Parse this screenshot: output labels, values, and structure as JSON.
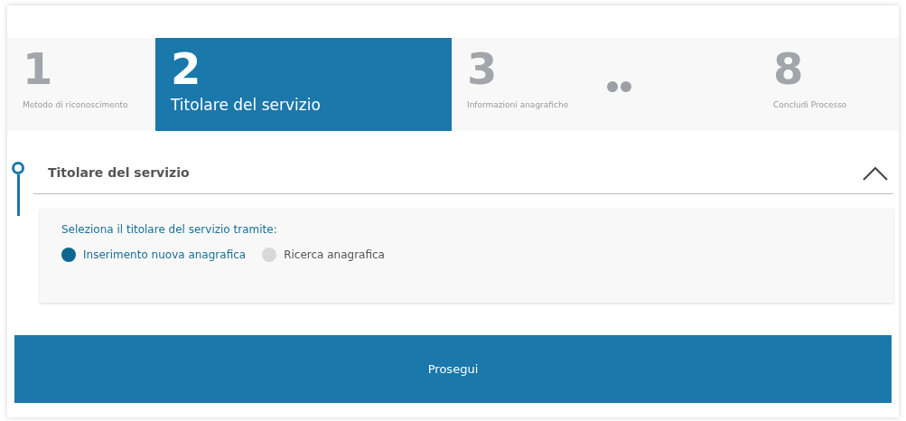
{
  "steps": [
    {
      "kind": "number",
      "number": "1",
      "label": "Metodo di riconoscimento",
      "selected": false
    },
    {
      "kind": "number",
      "number": "2",
      "label": "Titolare del servizio",
      "selected": true
    },
    {
      "kind": "number",
      "number": "3",
      "label": "Informazioni anagrafiche",
      "selected": false
    },
    {
      "kind": "ellipsis"
    },
    {
      "kind": "number",
      "number": "8",
      "label": "Concludi Processo",
      "selected": false
    }
  ],
  "section": {
    "title": "Titolare del servizio",
    "expanded": true,
    "prompt": "Seleziona il titolare del servizio tramite:",
    "options": [
      {
        "label": "Inserimento nuova anagrafica",
        "selected": true
      },
      {
        "label": "Ricerca anagrafica",
        "selected": false
      }
    ]
  },
  "button": "Prosegui"
}
